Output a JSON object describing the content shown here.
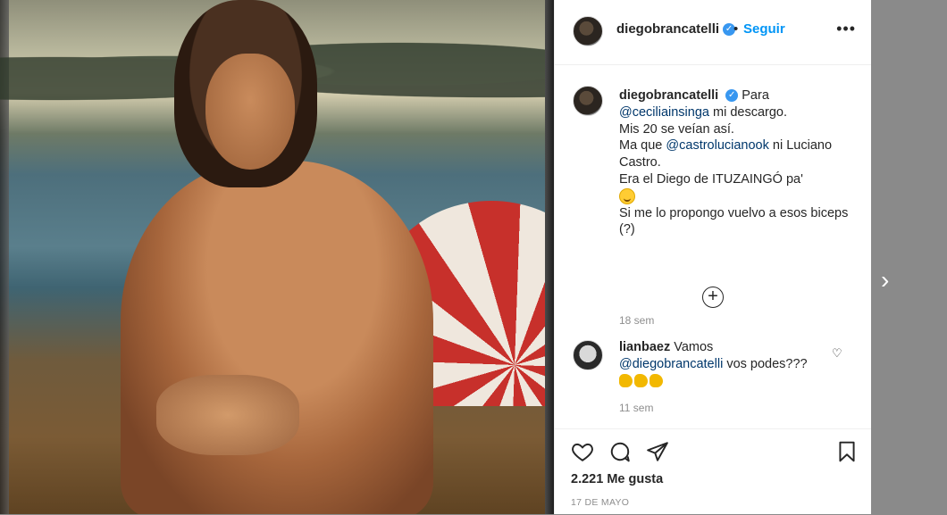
{
  "header": {
    "username": "diegobrancatelli",
    "dot": "•",
    "follow_label": "Seguir",
    "more_label": "•••"
  },
  "caption": {
    "username": "diegobrancatelli",
    "intro": "Para",
    "mention1": "@ceciliainsinga",
    "line1_rest": "mi descargo.",
    "line2": "Mis 20 se veían así.",
    "line3_pre": "Ma que",
    "mention2": "@castrolucianook",
    "line3_post": "ni Luciano Castro.",
    "line4": "Era el Diego de ITUZAINGÓ pa'",
    "line5": "Si me lo propongo vuelvo a esos biceps (?)",
    "time": "18 sem"
  },
  "load_more_label": "+",
  "comment": {
    "username": "lianbaez",
    "text1": "Vamos",
    "mention": "@diegobrancatelli",
    "text2": "vos podes???",
    "time": "11 sem"
  },
  "actions": {
    "likes": "2.221 Me gusta",
    "date": "17 DE MAYO"
  },
  "nav": {
    "next_label": "›"
  },
  "colors": {
    "link": "#00376b",
    "follow": "#0095f6",
    "verified": "#3897f0",
    "muted": "#8e8e8e"
  },
  "icons": [
    "verified-icon",
    "more-icon",
    "add-comments-icon",
    "heart-icon",
    "comment-icon",
    "share-icon",
    "save-icon",
    "next-arrow-icon",
    "smile-emoji-icon",
    "flexed-biceps-emoji-icon"
  ]
}
